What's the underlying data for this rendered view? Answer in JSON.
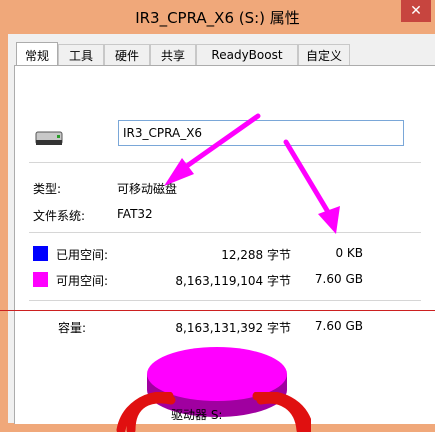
{
  "window": {
    "title": "IR3_CPRA_X6 (S:) 属性",
    "close_glyph": "✕"
  },
  "tabs": [
    {
      "label": "常规",
      "active": true
    },
    {
      "label": "工具"
    },
    {
      "label": "硬件"
    },
    {
      "label": "共享"
    },
    {
      "label": "ReadyBoost"
    },
    {
      "label": "自定义"
    }
  ],
  "general": {
    "drive_icon": "usb-drive-icon",
    "volume_name": "IR3_CPRA_X6",
    "type_label": "类型:",
    "type_value": "可移动磁盘",
    "fs_label": "文件系统:",
    "fs_value": "FAT32",
    "used_label": "已用空间:",
    "used_bytes": "12,288 字节",
    "used_size": "0 KB",
    "free_label": "可用空间:",
    "free_bytes": "8,163,119,104 字节",
    "free_size": "7.60 GB",
    "capacity_label": "容量:",
    "capacity_bytes": "8,163,131,392 字节",
    "capacity_size": "7.60 GB",
    "drive_label": "驱动器 S:",
    "used_color": "#0000ff",
    "free_color": "#ff00ff"
  },
  "pie": {
    "used_fraction": 1.5e-06,
    "free_fraction": 0.9999985
  }
}
